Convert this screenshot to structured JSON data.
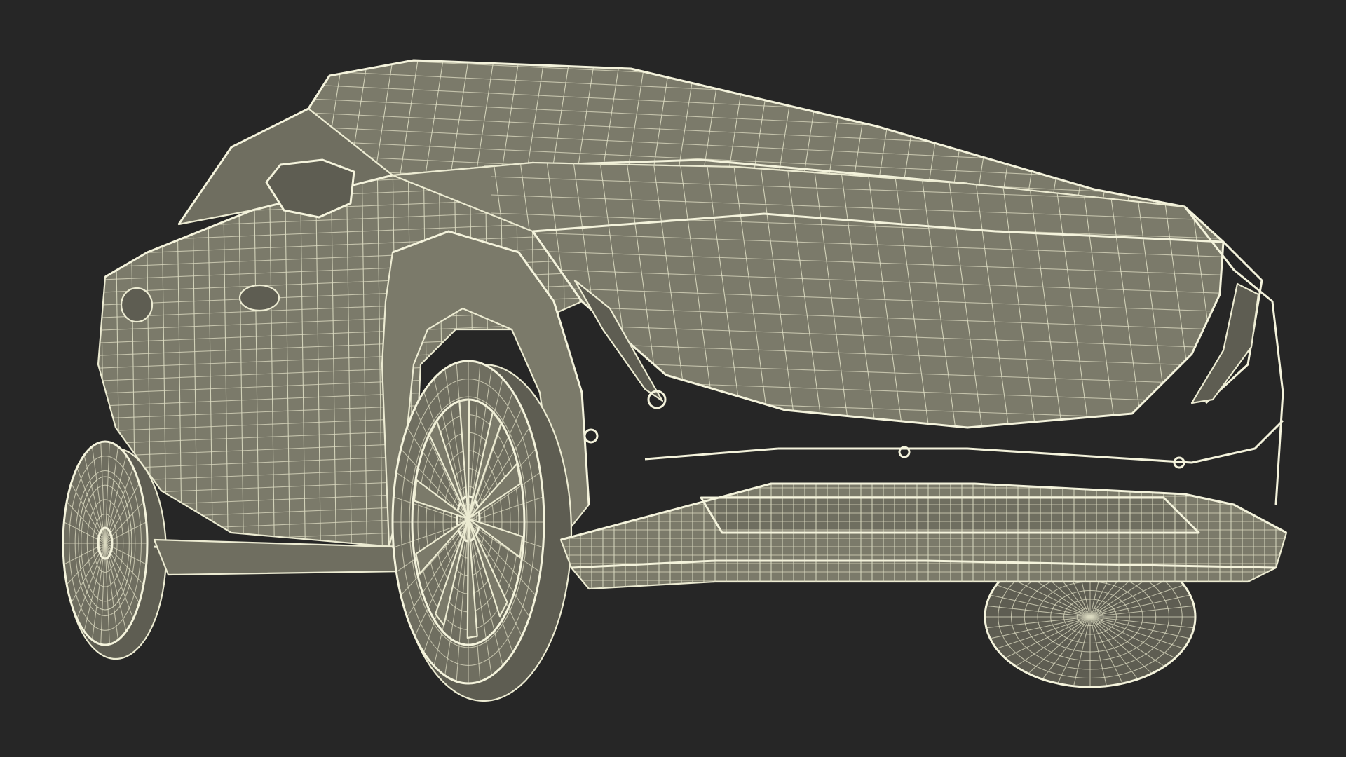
{
  "scene": {
    "subject": "car-wireframe",
    "background_color": "#262626",
    "model_fill_color": "#7b7a6a",
    "wire_color": "#ecebd2"
  }
}
